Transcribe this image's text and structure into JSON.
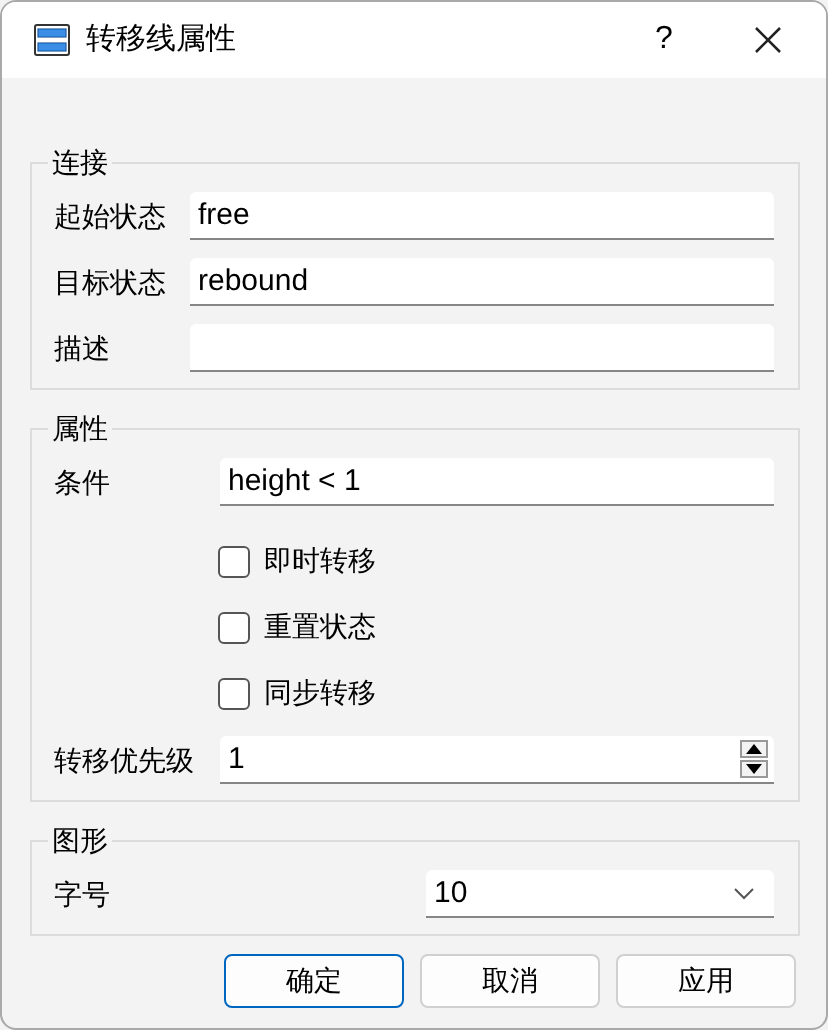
{
  "window": {
    "title": "转移线属性",
    "help": "?"
  },
  "groups": [
    {
      "title": "连接",
      "rows": [
        {
          "kind": "field",
          "label": "起始状态",
          "value": "free"
        },
        {
          "kind": "field",
          "label": "目标状态",
          "value": "rebound"
        },
        {
          "kind": "field",
          "label": "描述"
        }
      ]
    },
    {
      "title": "属性",
      "rows": [
        {
          "kind": "field",
          "label": "条件",
          "value": "height < 1"
        },
        {
          "kind": "checkbox",
          "label": "即时转移",
          "checked": false
        },
        {
          "kind": "checkbox",
          "label": "重置状态",
          "checked": false
        },
        {
          "kind": "checkbox",
          "label": "同步转移",
          "checked": false
        },
        {
          "kind": "spin",
          "label": "转移优先级",
          "value": "1"
        }
      ]
    },
    {
      "title": "图形",
      "rows": [
        {
          "kind": "combo",
          "label": "字号",
          "value": "10"
        }
      ]
    }
  ],
  "buttons": [
    {
      "label": "确定",
      "default": true
    },
    {
      "label": "取消",
      "default": false
    },
    {
      "label": "应用",
      "default": false
    }
  ]
}
